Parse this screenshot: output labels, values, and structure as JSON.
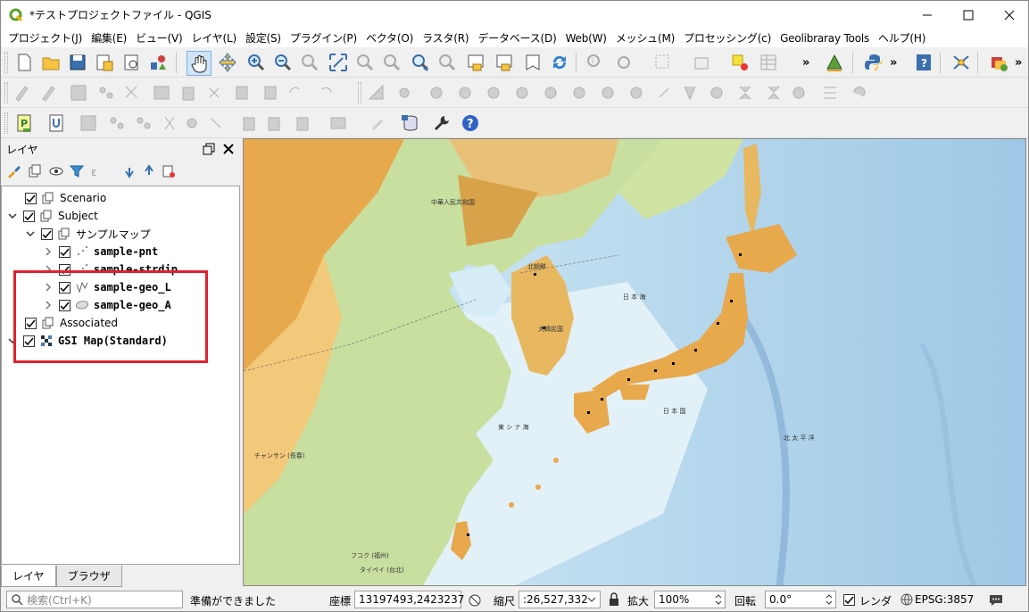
{
  "window": {
    "title": "*テストプロジェクトファイル - QGIS"
  },
  "menu": [
    "プロジェクト(J)",
    "編集(E)",
    "ビュー(V)",
    "レイヤ(L)",
    "設定(S)",
    "プラグイン(P)",
    "ベクタ(O)",
    "ラスタ(R)",
    "データベース(D)",
    "Web(W)",
    "メッシュ(M)",
    "プロセッシング(c)",
    "Geolibraray Tools",
    "ヘルプ(H)"
  ],
  "layers_panel": {
    "title": "レイヤ",
    "tree": [
      {
        "label": "Scenario",
        "checked": true
      },
      {
        "label": "Subject",
        "checked": true
      },
      {
        "label": "サンプルマップ",
        "checked": true
      },
      {
        "label": "sample-pnt",
        "checked": true
      },
      {
        "label": "sample-strdip",
        "checked": true
      },
      {
        "label": "sample-geo_L",
        "checked": true
      },
      {
        "label": "sample-geo_A",
        "checked": true
      },
      {
        "label": "Associated",
        "checked": true
      },
      {
        "label": "GSI Map(Standard)",
        "checked": true
      }
    ],
    "tabs": [
      "レイヤ",
      "ブラウザ"
    ]
  },
  "map_labels": {
    "china_north": "中華人民共和国",
    "nkorea": "北朝鮮",
    "skorea": "大韓民国",
    "sea_of_japan": "日 本 海",
    "east_china_sea": "東 シ ナ 海",
    "japan": "日 本 国",
    "pacific": "北 太 平 洋",
    "city_a": "チャンサン (長春)",
    "city_b": "フコク (福州)",
    "city_c": "タイペイ (台北)"
  },
  "status": {
    "search_placeholder": "検索(Ctrl+K)",
    "message": "準備ができました",
    "coord_label": "座標",
    "coord_value": "13197493,2423237",
    "scale_label": "縮尺",
    "scale_value": ":26,527,332",
    "magnifier_label": "拡大",
    "magnifier_value": "100%",
    "rotation_label": "回転",
    "rotation_value": "0.0°",
    "render_label": "レンダ",
    "crs_label": "EPSG:3857"
  },
  "colors": {
    "highlight": "#e02030",
    "ocean": "#cfe8f5",
    "land_low": "#c8dfa0",
    "land_high": "#e8a84c"
  }
}
